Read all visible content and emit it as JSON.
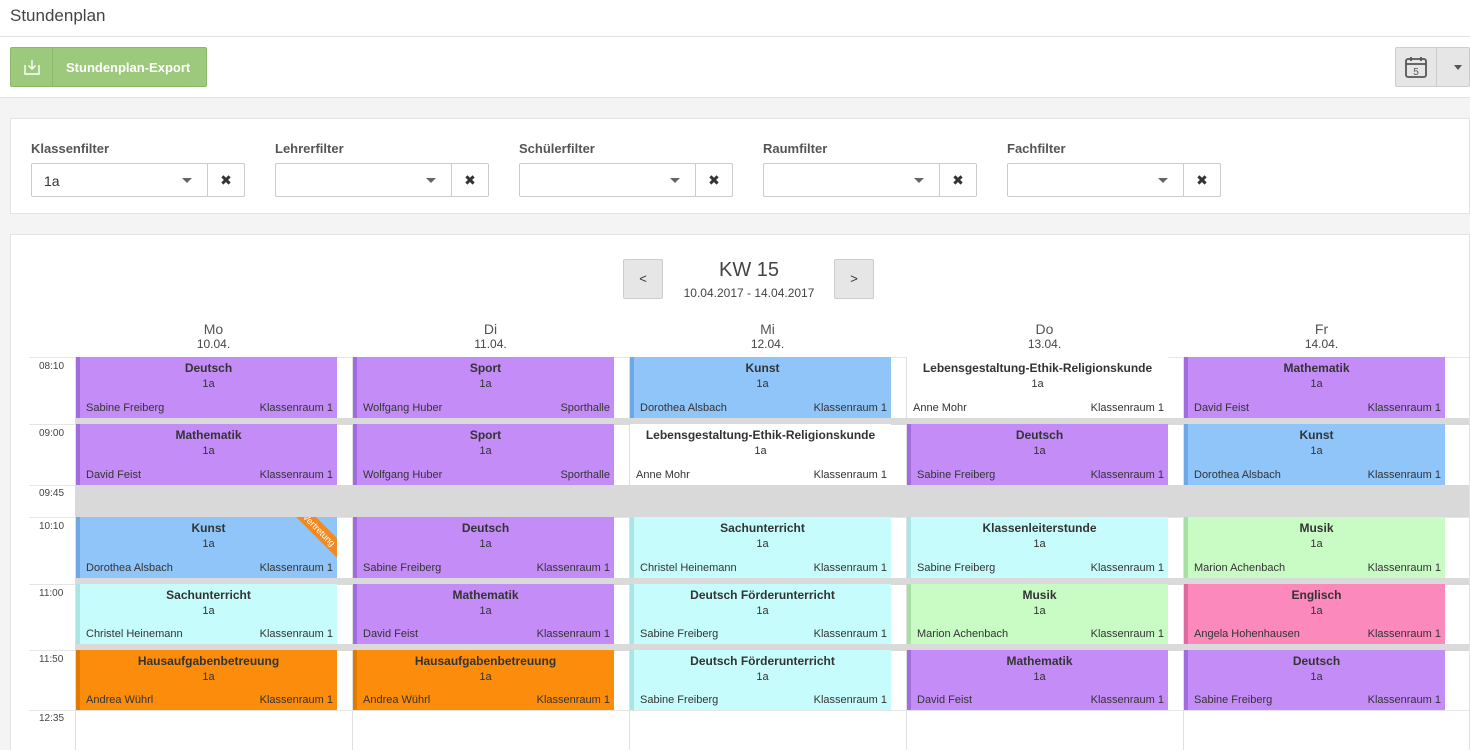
{
  "header": {
    "title": "Stundenplan"
  },
  "toolbar": {
    "export_label": "Stundenplan-Export",
    "calendar_badge": "5"
  },
  "filters": [
    {
      "label": "Klassenfilter",
      "value": "1a"
    },
    {
      "label": "Lehrerfilter",
      "value": ""
    },
    {
      "label": "Schülerfilter",
      "value": ""
    },
    {
      "label": "Raumfilter",
      "value": ""
    },
    {
      "label": "Fachfilter",
      "value": ""
    }
  ],
  "clear_symbol": "✖",
  "week": {
    "title": "KW 15",
    "range": "10.04.2017 - 14.04.2017",
    "prev": "<",
    "next": ">"
  },
  "days": [
    {
      "name": "Mo",
      "date": "10.04."
    },
    {
      "name": "Di",
      "date": "11.04."
    },
    {
      "name": "Mi",
      "date": "12.04."
    },
    {
      "name": "Do",
      "date": "13.04."
    },
    {
      "name": "Fr",
      "date": "14.04."
    }
  ],
  "times": [
    "08:10",
    "09:00",
    "09:45",
    "10:10",
    "11:00",
    "11:50",
    "12:35"
  ],
  "colors": {
    "purple": "#c48cf7",
    "blue": "#8fc5f9",
    "white": "#ffffff",
    "cyan": "#c6fcfc",
    "green": "#c8fcc4",
    "orange": "#fb8c0c",
    "pink": "#fb89bc"
  },
  "lessons": [
    {
      "day": 0,
      "slot": 0,
      "subject": "Deutsch",
      "class": "1a",
      "teacher": "Sabine Freiberg",
      "room": "Klassenraum 1",
      "color": "purple"
    },
    {
      "day": 1,
      "slot": 0,
      "subject": "Sport",
      "class": "1a",
      "teacher": "Wolfgang Huber",
      "room": "Sporthalle",
      "color": "purple"
    },
    {
      "day": 2,
      "slot": 0,
      "subject": "Kunst",
      "class": "1a",
      "teacher": "Dorothea Alsbach",
      "room": "Klassenraum 1",
      "color": "blue"
    },
    {
      "day": 3,
      "slot": 0,
      "subject": "Lebensgestaltung-Ethik-Religionskunde",
      "class": "1a",
      "teacher": "Anne Mohr",
      "room": "Klassenraum 1",
      "color": "white"
    },
    {
      "day": 4,
      "slot": 0,
      "subject": "Mathematik",
      "class": "1a",
      "teacher": "David Feist",
      "room": "Klassenraum 1",
      "color": "purple"
    },
    {
      "day": 0,
      "slot": 1,
      "subject": "Mathematik",
      "class": "1a",
      "teacher": "David Feist",
      "room": "Klassenraum 1",
      "color": "purple"
    },
    {
      "day": 1,
      "slot": 1,
      "subject": "Sport",
      "class": "1a",
      "teacher": "Wolfgang Huber",
      "room": "Sporthalle",
      "color": "purple"
    },
    {
      "day": 2,
      "slot": 1,
      "subject": "Lebensgestaltung-Ethik-Religionskunde",
      "class": "1a",
      "teacher": "Anne Mohr",
      "room": "Klassenraum 1",
      "color": "white"
    },
    {
      "day": 3,
      "slot": 1,
      "subject": "Deutsch",
      "class": "1a",
      "teacher": "Sabine Freiberg",
      "room": "Klassenraum 1",
      "color": "purple"
    },
    {
      "day": 4,
      "slot": 1,
      "subject": "Kunst",
      "class": "1a",
      "teacher": "Dorothea Alsbach",
      "room": "Klassenraum 1",
      "color": "blue"
    },
    {
      "day": 0,
      "slot": 2,
      "subject": "Kunst",
      "class": "1a",
      "teacher": "Dorothea Alsbach",
      "room": "Klassenraum 1",
      "color": "blue",
      "badge": "Vertretung"
    },
    {
      "day": 1,
      "slot": 2,
      "subject": "Deutsch",
      "class": "1a",
      "teacher": "Sabine Freiberg",
      "room": "Klassenraum 1",
      "color": "purple"
    },
    {
      "day": 2,
      "slot": 2,
      "subject": "Sachunterricht",
      "class": "1a",
      "teacher": "Christel Heinemann",
      "room": "Klassenraum 1",
      "color": "cyan"
    },
    {
      "day": 3,
      "slot": 2,
      "subject": "Klassenleiterstunde",
      "class": "1a",
      "teacher": "Sabine Freiberg",
      "room": "Klassenraum 1",
      "color": "cyan"
    },
    {
      "day": 4,
      "slot": 2,
      "subject": "Musik",
      "class": "1a",
      "teacher": "Marion Achenbach",
      "room": "Klassenraum 1",
      "color": "green"
    },
    {
      "day": 0,
      "slot": 3,
      "subject": "Sachunterricht",
      "class": "1a",
      "teacher": "Christel Heinemann",
      "room": "Klassenraum 1",
      "color": "cyan"
    },
    {
      "day": 1,
      "slot": 3,
      "subject": "Mathematik",
      "class": "1a",
      "teacher": "David Feist",
      "room": "Klassenraum 1",
      "color": "purple"
    },
    {
      "day": 2,
      "slot": 3,
      "subject": "Deutsch Förderunterricht",
      "class": "1a",
      "teacher": "Sabine Freiberg",
      "room": "Klassenraum 1",
      "color": "cyan"
    },
    {
      "day": 3,
      "slot": 3,
      "subject": "Musik",
      "class": "1a",
      "teacher": "Marion Achenbach",
      "room": "Klassenraum 1",
      "color": "green"
    },
    {
      "day": 4,
      "slot": 3,
      "subject": "Englisch",
      "class": "1a",
      "teacher": "Angela Hohenhausen",
      "room": "Klassenraum 1",
      "color": "pink"
    },
    {
      "day": 0,
      "slot": 4,
      "subject": "Hausaufgabenbetreuung",
      "class": "1a",
      "teacher": "Andrea Wührl",
      "room": "Klassenraum 1",
      "color": "orange"
    },
    {
      "day": 1,
      "slot": 4,
      "subject": "Hausaufgabenbetreuung",
      "class": "1a",
      "teacher": "Andrea Wührl",
      "room": "Klassenraum 1",
      "color": "orange"
    },
    {
      "day": 2,
      "slot": 4,
      "subject": "Deutsch Förderunterricht",
      "class": "1a",
      "teacher": "Sabine Freiberg",
      "room": "Klassenraum 1",
      "color": "cyan"
    },
    {
      "day": 3,
      "slot": 4,
      "subject": "Mathematik",
      "class": "1a",
      "teacher": "David Feist",
      "room": "Klassenraum 1",
      "color": "purple"
    },
    {
      "day": 4,
      "slot": 4,
      "subject": "Deutsch",
      "class": "1a",
      "teacher": "Sabine Freiberg",
      "room": "Klassenraum 1",
      "color": "purple"
    }
  ]
}
